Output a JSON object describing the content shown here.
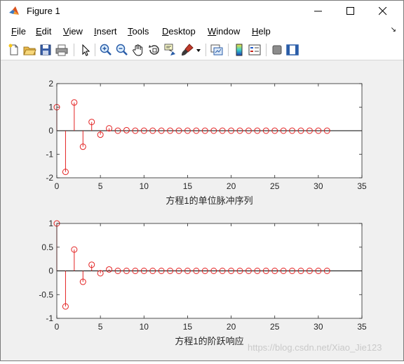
{
  "window": {
    "title": "Figure 1"
  },
  "menu": [
    {
      "label": "File",
      "u": "F",
      "rest": "ile"
    },
    {
      "label": "Edit",
      "u": "E",
      "rest": "dit"
    },
    {
      "label": "View",
      "u": "V",
      "rest": "iew"
    },
    {
      "label": "Insert",
      "u": "I",
      "rest": "nsert"
    },
    {
      "label": "Tools",
      "u": "T",
      "rest": "ools"
    },
    {
      "label": "Desktop",
      "u": "D",
      "rest": "esktop"
    },
    {
      "label": "Window",
      "u": "W",
      "rest": "indow"
    },
    {
      "label": "Help",
      "u": "H",
      "rest": "elp"
    }
  ],
  "toolbar_icons": [
    "new-figure-icon",
    "open-file-icon",
    "save-icon",
    "print-icon",
    "select-arrow-icon",
    "zoom-in-icon",
    "zoom-out-icon",
    "pan-hand-icon",
    "rotate-3d-icon",
    "data-cursor-icon",
    "brush-icon",
    "brush-dropdown-icon",
    "link-plot-icon",
    "colorbar-icon",
    "legend-icon",
    "hide-plot-tools-icon",
    "show-plot-tools-icon"
  ],
  "chart_data": [
    {
      "type": "stem",
      "xlabel": "方程1的单位脉冲序列",
      "xlim": [
        0,
        35
      ],
      "ylim": [
        -2,
        2
      ],
      "xticks": [
        0,
        5,
        10,
        15,
        20,
        25,
        30,
        35
      ],
      "yticks": [
        -2,
        -1,
        0,
        1,
        2
      ],
      "color": "#e32222",
      "x": [
        0,
        1,
        2,
        3,
        4,
        5,
        6,
        7,
        8,
        9,
        10,
        11,
        12,
        13,
        14,
        15,
        16,
        17,
        18,
        19,
        20,
        21,
        22,
        23,
        24,
        25,
        26,
        27,
        28,
        29,
        30,
        31
      ],
      "values": [
        1,
        -1.75,
        1.2,
        -0.68,
        0.37,
        -0.17,
        0.1,
        0,
        0.02,
        0,
        0,
        0,
        0,
        0,
        0,
        0,
        0,
        0,
        0,
        0,
        0,
        0,
        0,
        0,
        0,
        0,
        0,
        0,
        0,
        0,
        0,
        0
      ]
    },
    {
      "type": "stem",
      "xlabel": "方程1的阶跃响应",
      "xlim": [
        0,
        35
      ],
      "ylim": [
        -1,
        1
      ],
      "xticks": [
        0,
        5,
        10,
        15,
        20,
        25,
        30,
        35
      ],
      "yticks": [
        -1,
        -0.5,
        0,
        0.5,
        1
      ],
      "color": "#e32222",
      "x": [
        0,
        1,
        2,
        3,
        4,
        5,
        6,
        7,
        8,
        9,
        10,
        11,
        12,
        13,
        14,
        15,
        16,
        17,
        18,
        19,
        20,
        21,
        22,
        23,
        24,
        25,
        26,
        27,
        28,
        29,
        30,
        31
      ],
      "values": [
        1,
        -0.75,
        0.45,
        -0.23,
        0.13,
        -0.05,
        0.03,
        0,
        0,
        0,
        0,
        0,
        0,
        0,
        0,
        0,
        0,
        0,
        0,
        0,
        0,
        0,
        0,
        0,
        0,
        0,
        0,
        0,
        0,
        0,
        0,
        0
      ]
    }
  ],
  "watermark": "https://blog.csdn.net/Xiao_Jie123"
}
